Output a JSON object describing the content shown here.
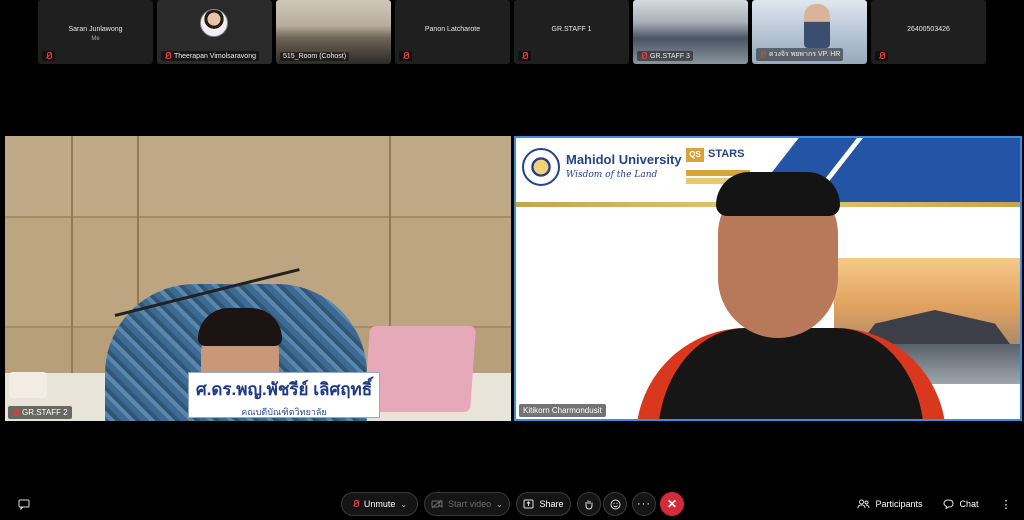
{
  "participants_strip": [
    {
      "name": "Saran Junlawong",
      "sub": "Me",
      "muted": false,
      "kind": "name"
    },
    {
      "name": "Theerapan Vimolsaravong",
      "muted": true,
      "kind": "avatar"
    },
    {
      "name": "515_Room (Cohost)",
      "muted": false,
      "kind": "room"
    },
    {
      "name": "Panon Latcharote",
      "muted": true,
      "kind": "name"
    },
    {
      "name": "GR.STAFF 1",
      "muted": true,
      "kind": "name"
    },
    {
      "name": "GR.STAFF 3",
      "muted": true,
      "kind": "hall"
    },
    {
      "name": "ดวงจิร พยพากร VP. HR",
      "muted": true,
      "kind": "office"
    },
    {
      "name": "26400503426",
      "muted": true,
      "kind": "name"
    }
  ],
  "main_tiles": {
    "left": {
      "label": "GR.STAFF 2",
      "nameplate_line1": "ศ.ดร.พญ.พัชรีย์ เลิศฤทธิ์",
      "nameplate_line2": "คณบดีบัณฑิตวิทยาลัย"
    },
    "right": {
      "label": "Kitikorn Charmondusit",
      "slide_title": "Mahidol University",
      "slide_subtitle": "Wisdom of the Land",
      "qs_text": "STARS",
      "qs_logo": "QS"
    }
  },
  "toolbar": {
    "unmute_label": "Unmute",
    "start_video_label": "Start video",
    "share_label": "Share",
    "participants_label": "Participants",
    "chat_label": "Chat"
  },
  "colors": {
    "accent_border": "#3b8de0",
    "hangup": "#d32b3a",
    "muted_icon": "#e23b3b"
  }
}
